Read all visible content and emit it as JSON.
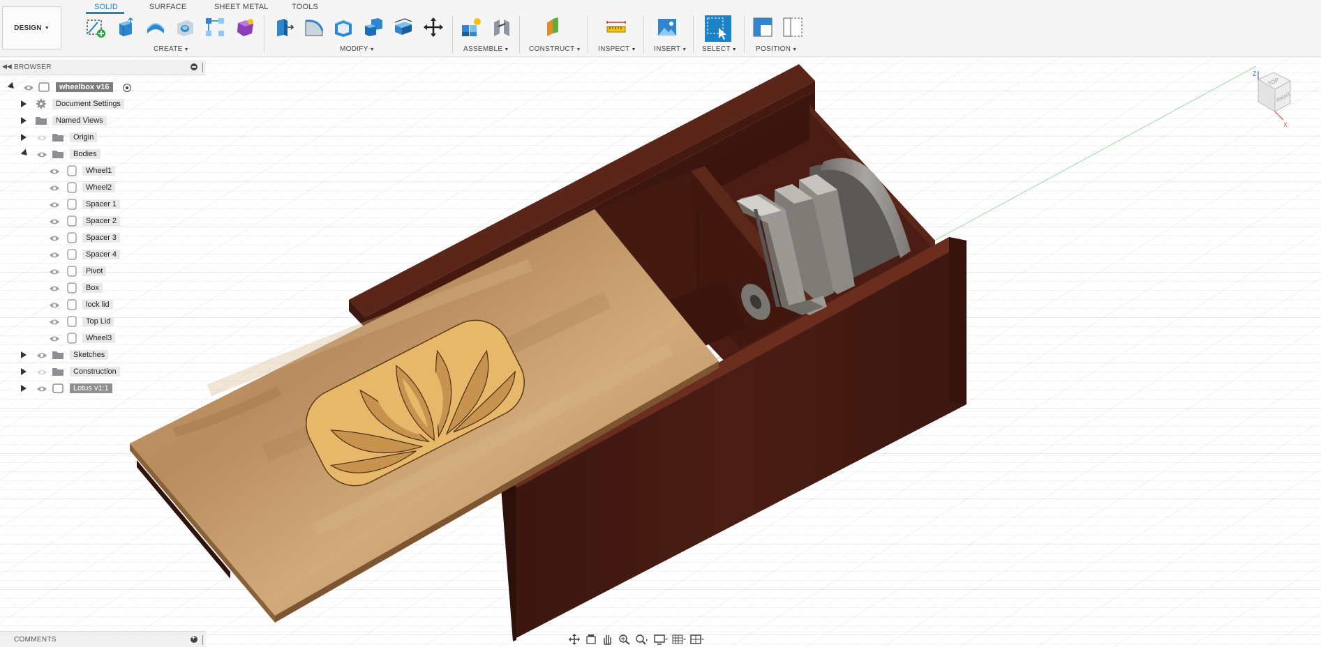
{
  "toolbar": {
    "workspace": "DESIGN",
    "tabs": [
      {
        "label": "SOLID",
        "active": true
      },
      {
        "label": "SURFACE",
        "active": false
      },
      {
        "label": "SHEET METAL",
        "active": false
      },
      {
        "label": "TOOLS",
        "active": false
      }
    ],
    "groups": [
      {
        "label": "CREATE",
        "tools": [
          "create-sketch-icon",
          "extrude-icon",
          "revolve-icon",
          "hole-icon",
          "rectangular-pattern-icon",
          "create-form-icon"
        ]
      },
      {
        "label": "MODIFY",
        "tools": [
          "press-pull-icon",
          "fillet-icon",
          "shell-icon",
          "combine-icon",
          "offset-face-icon",
          "move-icon"
        ]
      },
      {
        "label": "ASSEMBLE",
        "tools": [
          "new-component-icon",
          "joint-icon"
        ]
      },
      {
        "label": "CONSTRUCT",
        "tools": [
          "offset-plane-icon"
        ]
      },
      {
        "label": "INSPECT",
        "tools": [
          "measure-icon"
        ]
      },
      {
        "label": "INSERT",
        "tools": [
          "insert-image-icon"
        ]
      },
      {
        "label": "SELECT",
        "tools": [
          "select-icon"
        ]
      },
      {
        "label": "POSITION",
        "tools": [
          "capture-position-icon",
          "revert-position-icon"
        ]
      }
    ],
    "accent_color": "#1c84c6"
  },
  "browser": {
    "title": "BROWSER",
    "root": "wheelbox v16",
    "items": [
      {
        "label": "Document Settings",
        "icon": "gear-icon"
      },
      {
        "label": "Named Views",
        "icon": "folder-icon"
      },
      {
        "label": "Origin",
        "icon": "folder-icon"
      },
      {
        "label": "Bodies",
        "icon": "folder-icon",
        "expanded": true
      }
    ],
    "bodies": [
      "Wheel1",
      "Wheel2",
      "Spacer 1",
      "Spacer 2",
      "Spacer 3",
      "Spacer 4",
      "Pivot",
      "Box",
      "lock lid",
      "Top Lid",
      "Wheel3"
    ],
    "after": [
      {
        "label": "Sketches",
        "icon": "folder-icon"
      },
      {
        "label": "Construction",
        "icon": "folder-icon"
      },
      {
        "label": "Lotus v1:1",
        "icon": "component-icon"
      }
    ]
  },
  "viewcube": {
    "top": "TOP",
    "right": "RIGHT",
    "z": "Z",
    "x": "X"
  },
  "comments": {
    "title": "COMMENTS"
  },
  "navbar": {
    "icons": [
      "orbit-icon",
      "look-at-icon",
      "pan-icon",
      "zoom-icon",
      "fit-icon",
      "display-settings-icon",
      "grid-icon",
      "viewports-icon"
    ]
  },
  "colors": {
    "wood_dark": "#4a1e14",
    "wood_light": "#c9a070",
    "lotus": "#e8b86a"
  }
}
